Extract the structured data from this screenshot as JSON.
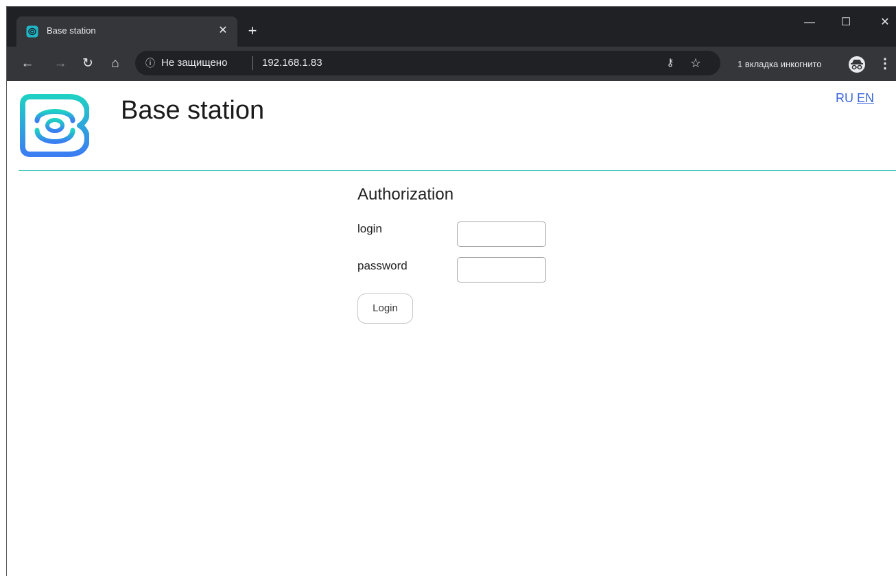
{
  "browser": {
    "tab": {
      "title": "Base station"
    },
    "address_bar": {
      "security_label": "Не защищено",
      "url": "192.168.1.83"
    },
    "incognito_label": "1 вкладка инкогнито"
  },
  "site": {
    "title": "Base station",
    "languages": [
      "RU",
      "EN"
    ],
    "active_language": "EN",
    "accent_color": "#2fc1b3",
    "link_color": "#3b66d9"
  },
  "auth": {
    "heading": "Authorization",
    "login_label": "login",
    "password_label": "password",
    "login_value": "",
    "password_value": "",
    "submit_label": "Login"
  }
}
